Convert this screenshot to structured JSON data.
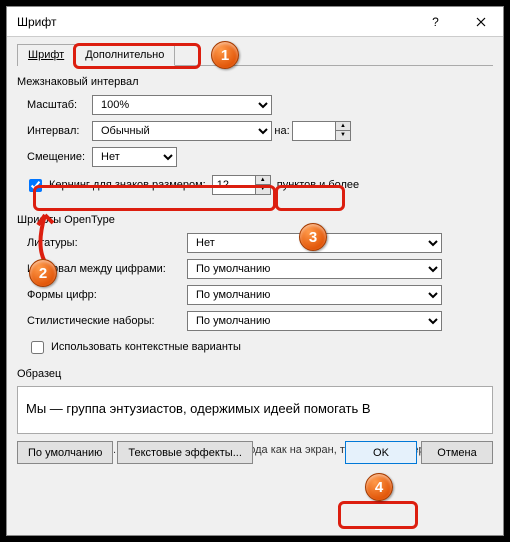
{
  "title": "Шрифт",
  "tabs": {
    "font": "Шрифт",
    "advanced": "Дополнительно"
  },
  "spacing": {
    "group": "Межзнаковый интервал",
    "scale_lbl": "Масштаб:",
    "scale_val": "100%",
    "spacing_lbl": "Интервал:",
    "spacing_val": "Обычный",
    "by_lbl": "на:",
    "by_val": "",
    "pos_lbl": "Смещение:",
    "pos_val": "Нет",
    "kern_lbl": "Кернинг для знаков размером:",
    "kern_val": "12",
    "kern_suffix": "пунктов и более"
  },
  "opentype": {
    "group": "Шрифты OpenType",
    "lig_lbl": "Лигатуры:",
    "lig_val": "Нет",
    "numsp_lbl": "Интервал между цифрами:",
    "numsp_val": "По умолчанию",
    "numfm_lbl": "Формы цифр:",
    "numfm_val": "По умолчанию",
    "sty_lbl": "Стилистические наборы:",
    "sty_val": "По умолчанию",
    "ctx_lbl": "Использовать контекстные варианты"
  },
  "sample": {
    "group": "Образец",
    "text": "Мы — группа энтузиастов, одержимых идеей помогать В",
    "hint": "Шрифт OpenType. Он используется для вывода как на экран, так и на принтер."
  },
  "buttons": {
    "default": "По умолчанию",
    "effects": "Текстовые эффекты...",
    "ok": "OK",
    "cancel": "Отмена"
  },
  "badges": {
    "b1": "1",
    "b2": "2",
    "b3": "3",
    "b4": "4"
  }
}
